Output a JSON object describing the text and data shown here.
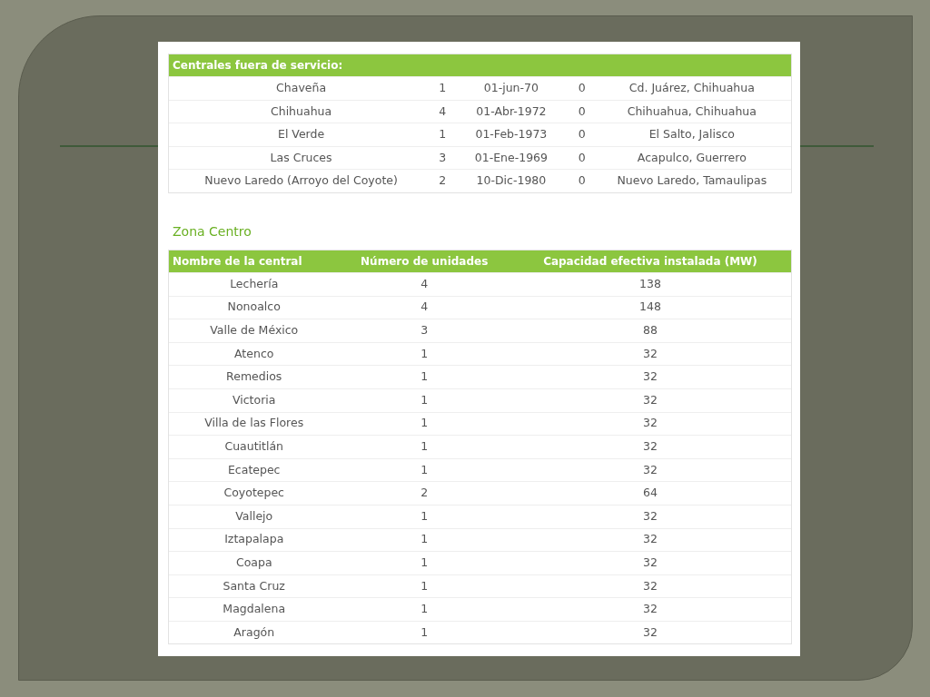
{
  "out_of_service": {
    "title": "Centrales fuera de servicio:",
    "rows": [
      [
        "Chaveña",
        "1",
        "01-jun-70",
        "0",
        "Cd. Juárez, Chihuahua"
      ],
      [
        "Chihuahua",
        "4",
        "01-Abr-1972",
        "0",
        "Chihuahua, Chihuahua"
      ],
      [
        "El Verde",
        "1",
        "01-Feb-1973",
        "0",
        "El Salto, Jalisco"
      ],
      [
        "Las Cruces",
        "3",
        "01-Ene-1969",
        "0",
        "Acapulco, Guerrero"
      ],
      [
        "Nuevo Laredo (Arroyo del Coyote)",
        "2",
        "10-Dic-1980",
        "0",
        "Nuevo Laredo, Tamaulipas"
      ]
    ]
  },
  "zona_centro": {
    "heading": "Zona Centro",
    "columns": [
      "Nombre de la central",
      "Número de unidades",
      "Capacidad efectiva instalada (MW)"
    ],
    "rows": [
      [
        "Lechería",
        "4",
        "138"
      ],
      [
        "Nonoalco",
        "4",
        "148"
      ],
      [
        "Valle de México",
        "3",
        "88"
      ],
      [
        "Atenco",
        "1",
        "32"
      ],
      [
        "Remedios",
        "1",
        "32"
      ],
      [
        "Victoria",
        "1",
        "32"
      ],
      [
        "Villa de las Flores",
        "1",
        "32"
      ],
      [
        "Cuautitlán",
        "1",
        "32"
      ],
      [
        "Ecatepec",
        "1",
        "32"
      ],
      [
        "Coyotepec",
        "2",
        "64"
      ],
      [
        "Vallejo",
        "1",
        "32"
      ],
      [
        "Iztapalapa",
        "1",
        "32"
      ],
      [
        "Coapa",
        "1",
        "32"
      ],
      [
        "Santa Cruz",
        "1",
        "32"
      ],
      [
        "Magdalena",
        "1",
        "32"
      ],
      [
        "Aragón",
        "1",
        "32"
      ]
    ]
  }
}
